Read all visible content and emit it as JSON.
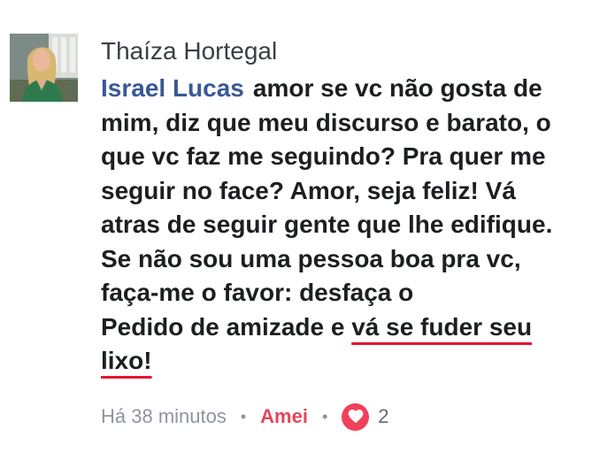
{
  "comment": {
    "author_name": "Thaíza Hortegal",
    "mention": "Israel Lucas",
    "lines": [
      "amor se vc não gosta de",
      "mim, diz que meu discurso e barato, o",
      "que vc faz me seguindo? Pra quer me",
      "seguir no face? Amor, seja feliz! Vá",
      "atras de seguir gente que lhe edifique.",
      "Se não sou uma pessoa boa pra vc,",
      "faça-me o favor: desfaça o"
    ],
    "line8_prefix": "Pedido de amizade e ",
    "line8_underlined": "vá se fuder seu",
    "line9_underlined": "lixo!",
    "timestamp": "Há 38 minutos",
    "separator": "•",
    "reaction_label": "Amei",
    "reaction_count": "2",
    "reaction_icon": "heart-icon"
  },
  "colors": {
    "author": "#3b3e45",
    "mention": "#385898",
    "love": "#e3465d",
    "underline": "#e8112d",
    "meta": "#90949c"
  }
}
